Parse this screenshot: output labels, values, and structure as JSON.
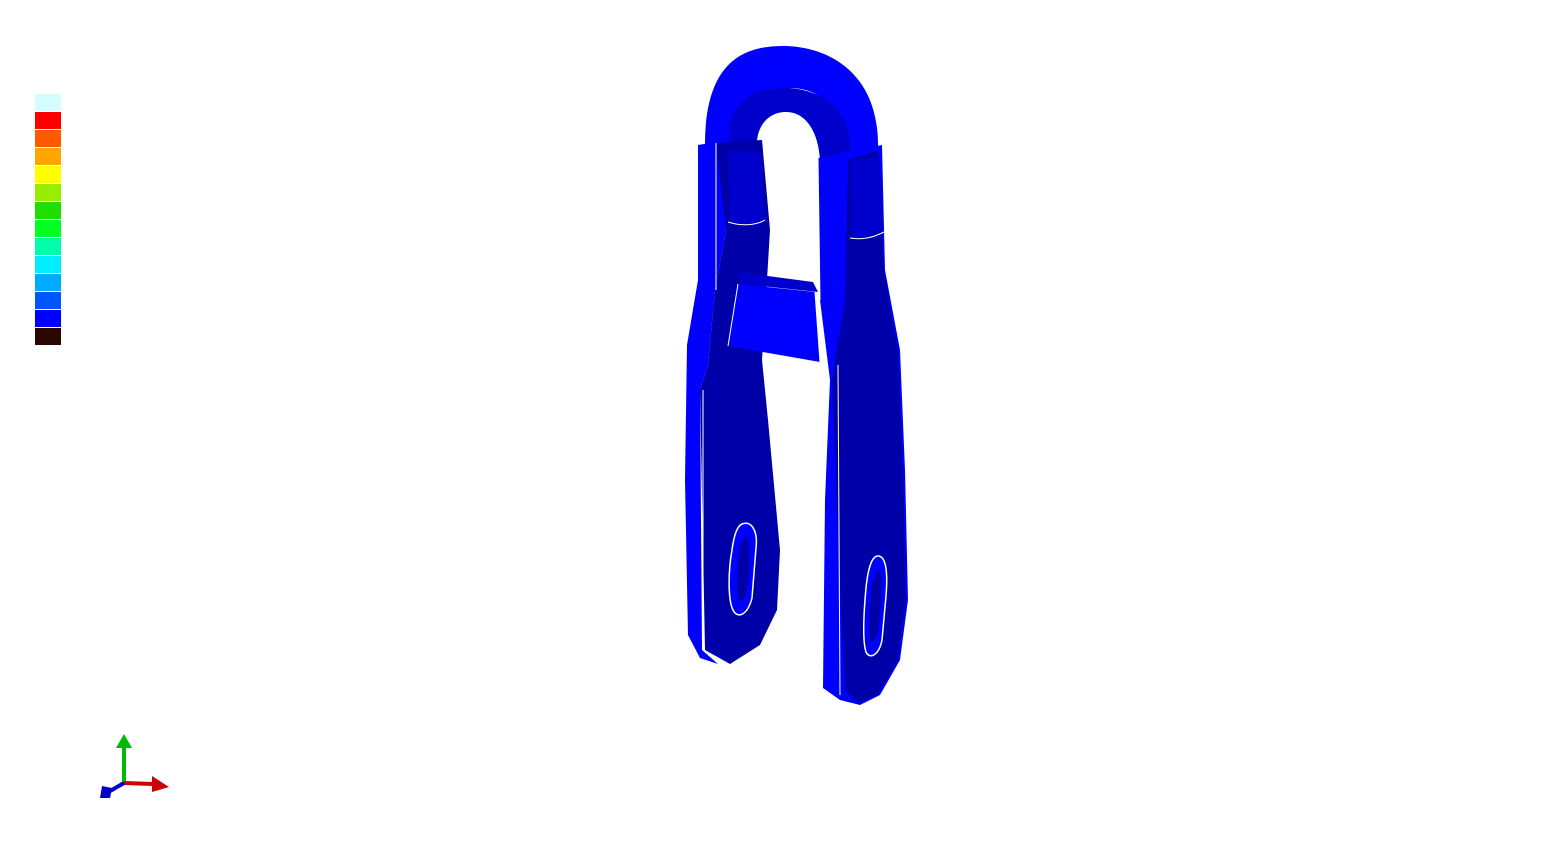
{
  "viewport": {
    "background": "#ffffff"
  },
  "legend": {
    "swatches": [
      {
        "color": "#d4fdfd",
        "name": "legend-swatch-overflow-high"
      },
      {
        "color": "#ff0000",
        "name": "legend-swatch-level-11"
      },
      {
        "color": "#ff5a00",
        "name": "legend-swatch-level-10"
      },
      {
        "color": "#ffa500",
        "name": "legend-swatch-level-9"
      },
      {
        "color": "#ffff00",
        "name": "legend-swatch-level-8"
      },
      {
        "color": "#99ee00",
        "name": "legend-swatch-level-7"
      },
      {
        "color": "#22dd00",
        "name": "legend-swatch-level-6"
      },
      {
        "color": "#00ff22",
        "name": "legend-swatch-level-5"
      },
      {
        "color": "#00ffaa",
        "name": "legend-swatch-level-4"
      },
      {
        "color": "#00eeff",
        "name": "legend-swatch-level-3"
      },
      {
        "color": "#00aaff",
        "name": "legend-swatch-level-2"
      },
      {
        "color": "#0055ff",
        "name": "legend-swatch-level-1"
      },
      {
        "color": "#0000ff",
        "name": "legend-swatch-level-0"
      },
      {
        "color": "#2a0a00",
        "name": "legend-swatch-overflow-low"
      }
    ]
  },
  "model": {
    "primary_color": "#0000ff",
    "shade_color": "#0000cc",
    "dark_shade_color": "#0000a8",
    "edge_color": "#ffffff"
  },
  "triad": {
    "x_color": "#cc0000",
    "y_color": "#00bb00",
    "z_color": "#0000cc"
  }
}
